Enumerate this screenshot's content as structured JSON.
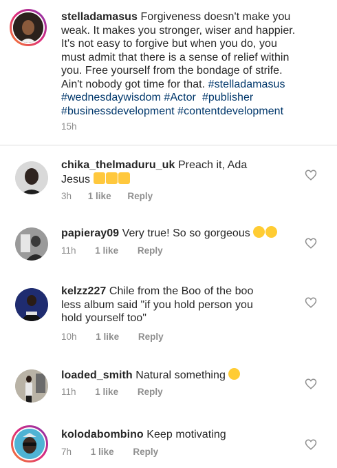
{
  "caption": {
    "username": "stelladamasus",
    "lines": [
      "Forgiveness doesn't make you",
      "weak. It makes you stronger, wiser and happier.",
      "It's not easy to forgive but when you do, you",
      "must admit that there is a sense of relief within",
      "you. Free yourself from the bondage of strife.",
      "Ain't nobody got time for that."
    ],
    "hashtags": [
      "#stelladamasus",
      "#wednesdaywisdom",
      "#Actor",
      "#publisher",
      "#businessdevelopment",
      "#contentdevelopment"
    ],
    "time": "15h"
  },
  "comments": [
    {
      "username": "chika_thelmaduru_uk",
      "text_line1": "Preach it, Ada",
      "text_line2": "Jesus",
      "emoji": [
        "thumbs-up",
        "thumbs-up",
        "thumbs-up"
      ],
      "time": "3h",
      "likes": "1 like",
      "reply": "Reply"
    },
    {
      "username": "papieray09",
      "text_line1": "Very true! So so gorgeous",
      "emoji": [
        "heart-eyes",
        "kissing-face"
      ],
      "time": "11h",
      "likes": "1 like",
      "reply": "Reply"
    },
    {
      "username": "kelzz227",
      "text_line1": "Chile from the Boo of the boo",
      "text_line2": "less album said \"if you hold person you",
      "text_line3": "hold yourself too\"",
      "time": "10h",
      "likes": "1 like",
      "reply": "Reply"
    },
    {
      "username": "loaded_smith",
      "text_line1": "Natural something",
      "emoji": [
        "tears-of-joy"
      ],
      "time": "11h",
      "likes": "1 like",
      "reply": "Reply"
    },
    {
      "username": "kolodabombino",
      "text_line1": "Keep motivating",
      "time": "7h",
      "likes": "1 like",
      "reply": "Reply"
    }
  ],
  "colors": {
    "text": "#262626",
    "hashtag": "#00376b",
    "meta": "#8e8e8e",
    "divider": "#dbdbdb",
    "story_ring": [
      "#f58529",
      "#dd2a7b",
      "#8134af"
    ]
  }
}
